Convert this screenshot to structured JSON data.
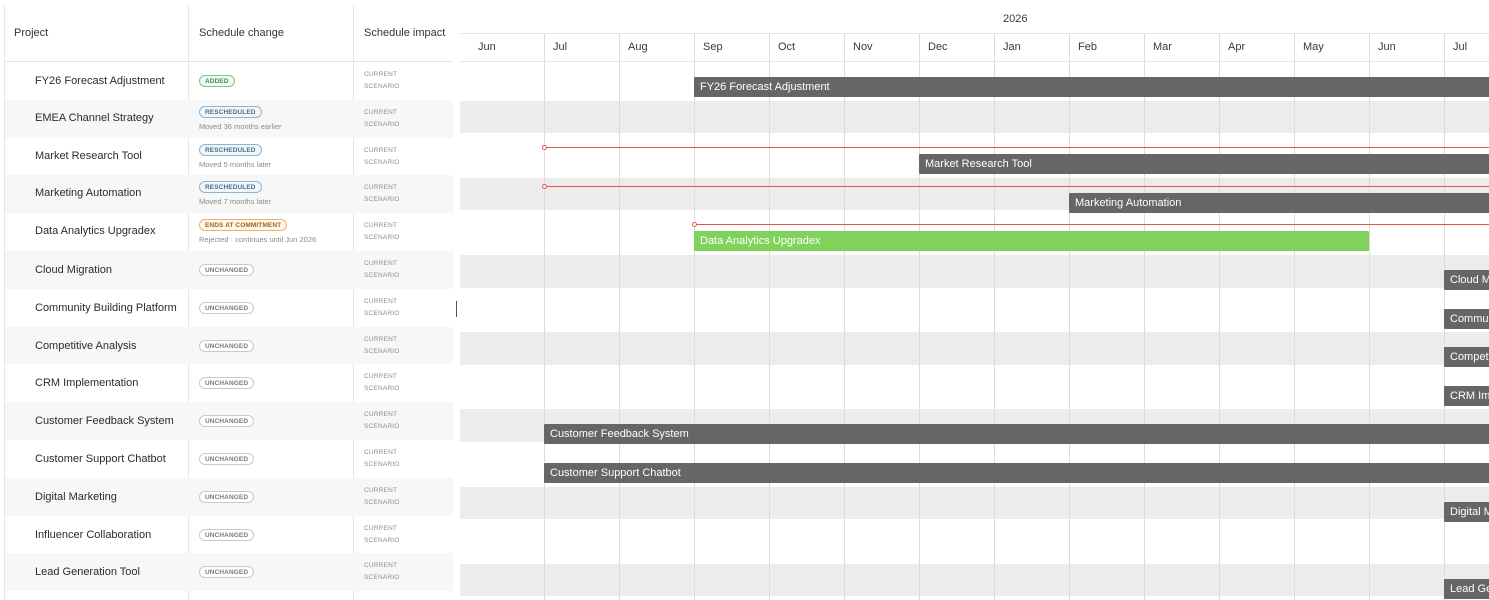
{
  "table": {
    "headers": {
      "project": "Project",
      "change": "Schedule change",
      "impact": "Schedule impact"
    },
    "impact_line1": "CURRENT",
    "impact_line2": "SCENARIO",
    "rows": [
      {
        "name": "FY26 Forecast Adjustment",
        "badge": "ADDED",
        "kind": "added",
        "note": ""
      },
      {
        "name": "EMEA Channel Strategy",
        "badge": "RESCHEDULED",
        "kind": "rescheduled",
        "note": "Moved 36 months earlier"
      },
      {
        "name": "Market Research Tool",
        "badge": "RESCHEDULED",
        "kind": "rescheduled",
        "note": "Moved 5 months later"
      },
      {
        "name": "Marketing Automation",
        "badge": "RESCHEDULED",
        "kind": "rescheduled",
        "note": "Moved 7 months later"
      },
      {
        "name": "Data Analytics Upgradex",
        "badge": "ENDS AT COMMITMENT",
        "kind": "ends",
        "note": "Rejected · continues until Jun 2026"
      },
      {
        "name": "Cloud Migration",
        "badge": "UNCHANGED",
        "kind": "unchanged",
        "note": ""
      },
      {
        "name": "Community Building Platform",
        "badge": "UNCHANGED",
        "kind": "unchanged",
        "note": ""
      },
      {
        "name": "Competitive Analysis",
        "badge": "UNCHANGED",
        "kind": "unchanged",
        "note": ""
      },
      {
        "name": "CRM Implementation",
        "badge": "UNCHANGED",
        "kind": "unchanged",
        "note": ""
      },
      {
        "name": "Customer Feedback System",
        "badge": "UNCHANGED",
        "kind": "unchanged",
        "note": ""
      },
      {
        "name": "Customer Support Chatbot",
        "badge": "UNCHANGED",
        "kind": "unchanged",
        "note": ""
      },
      {
        "name": "Digital Marketing",
        "badge": "UNCHANGED",
        "kind": "unchanged",
        "note": ""
      },
      {
        "name": "Influencer Collaboration",
        "badge": "UNCHANGED",
        "kind": "unchanged",
        "note": ""
      },
      {
        "name": "Lead Generation Tool",
        "badge": "UNCHANGED",
        "kind": "unchanged",
        "note": ""
      }
    ]
  },
  "gantt": {
    "year_label": "2026",
    "months": [
      "Jun",
      "Jul",
      "Aug",
      "Sep",
      "Oct",
      "Nov",
      "Dec",
      "Jan",
      "Feb",
      "Mar",
      "Apr",
      "May",
      "Jun",
      "Jul"
    ],
    "bars": [
      {
        "label": "FY26 Forecast Adjustment",
        "row": 0,
        "start_month": "Sep 2025",
        "color": "gray"
      },
      {
        "label": "Market Research Tool",
        "row": 2,
        "start_month": "Dec 2025",
        "color": "gray",
        "previous_start": "Jul 2025"
      },
      {
        "label": "Marketing Automation",
        "row": 3,
        "start_month": "Feb 2026",
        "color": "gray",
        "previous_start": "Jul 2025"
      },
      {
        "label": "Data Analytics Upgradex",
        "row": 4,
        "start_month": "Sep 2025",
        "end_month": "Jun 2026",
        "color": "green",
        "previous_start": "Sep 2025"
      },
      {
        "label": "Cloud Migration",
        "row": 5,
        "start_month": "Jul 2026",
        "color": "gray"
      },
      {
        "label": "Community Building Platform",
        "row": 6,
        "start_month": "Jul 2026",
        "color": "gray"
      },
      {
        "label": "Competitive Analysis",
        "row": 7,
        "start_month": "Jul 2026",
        "color": "gray"
      },
      {
        "label": "CRM Implementation",
        "row": 8,
        "start_month": "Jul 2026",
        "color": "gray"
      },
      {
        "label": "Customer Feedback System",
        "row": 9,
        "start_month": "Jul 2025",
        "color": "gray"
      },
      {
        "label": "Customer Support Chatbot",
        "row": 10,
        "start_month": "Jul 2025",
        "color": "gray"
      },
      {
        "label": "Digital Marketing",
        "row": 11,
        "start_month": "Jul 2026",
        "color": "gray"
      },
      {
        "label": "Lead Generation Tool",
        "row": 13,
        "start_month": "Jul 2026",
        "color": "gray"
      }
    ]
  },
  "colors": {
    "bar_gray": "#666666",
    "bar_green": "#7fd35b",
    "shift_line": "#e55252"
  }
}
